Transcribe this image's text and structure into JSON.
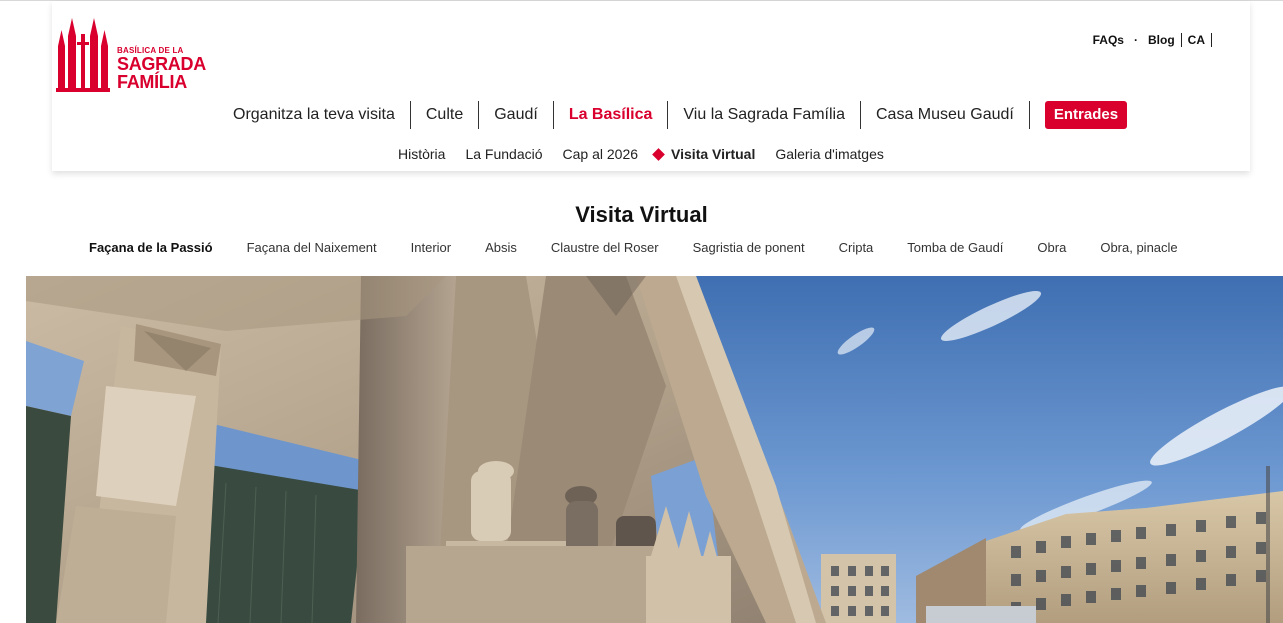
{
  "brand": {
    "line1": "BASÍLICA DE LA",
    "line2": "SAGRADA",
    "line3": "FAMÍLIA",
    "color": "#d9002e"
  },
  "utility_nav": {
    "faqs": "FAQs",
    "blog": "Blog",
    "language": "CA"
  },
  "main_nav": {
    "items": [
      "Organitza la teva visita",
      "Culte",
      "Gaudí",
      "La Basílica",
      "Viu la Sagrada Família",
      "Casa Museu Gaudí"
    ],
    "active": "La Basílica",
    "cta": "Entrades"
  },
  "sub_nav": {
    "items": [
      "Història",
      "La Fundació",
      "Cap al 2026",
      "Visita Virtual",
      "Galeria d'imatges"
    ],
    "active": "Visita Virtual"
  },
  "page": {
    "title": "Visita Virtual"
  },
  "tour_tabs": {
    "items": [
      "Façana de la Passió",
      "Façana del Naixement",
      "Interior",
      "Absis",
      "Claustre del Roser",
      "Sagristia de ponent",
      "Cripta",
      "Tomba de Gaudí",
      "Obra",
      "Obra, pinacle"
    ],
    "active": "Façana de la Passió"
  },
  "viewer": {
    "scene": "passion-facade-panorama"
  }
}
